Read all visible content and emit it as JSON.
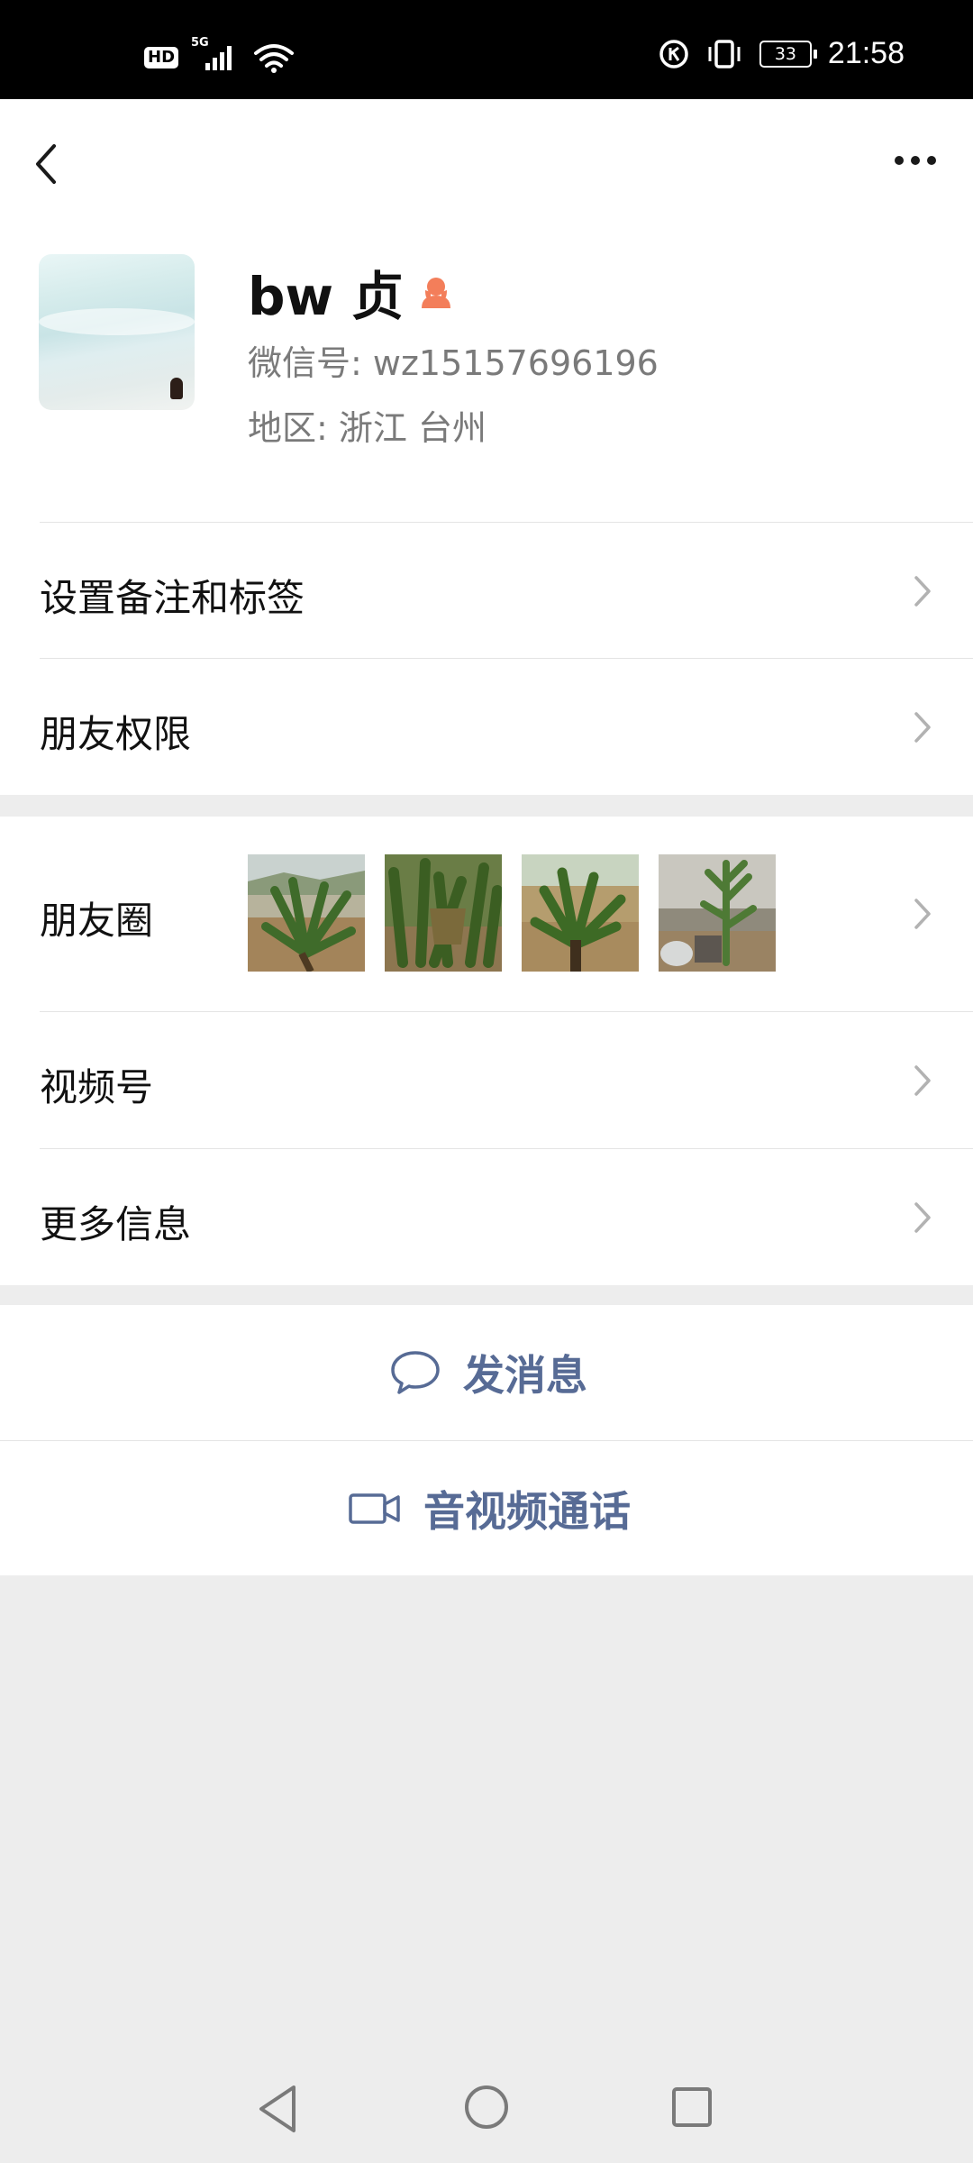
{
  "status_bar": {
    "hd_label": "HD",
    "network_label": "5G",
    "battery_level": "33",
    "time": "21:58"
  },
  "profile": {
    "name": "bw 贞",
    "wechat_id": "微信号:  wz15157696196",
    "region": "地区:  浙江  台州",
    "gender_icon": "female-icon",
    "colors": {
      "gender_icon": "#f37e5a"
    }
  },
  "menu": {
    "remark_tags": "设置备注和标签",
    "friend_permissions": "朋友权限",
    "moments": "朋友圈",
    "channels": "视频号",
    "more_info": "更多信息"
  },
  "actions": {
    "send_message": "发消息",
    "av_call": "音视频通话",
    "accent_color": "#576b95"
  }
}
